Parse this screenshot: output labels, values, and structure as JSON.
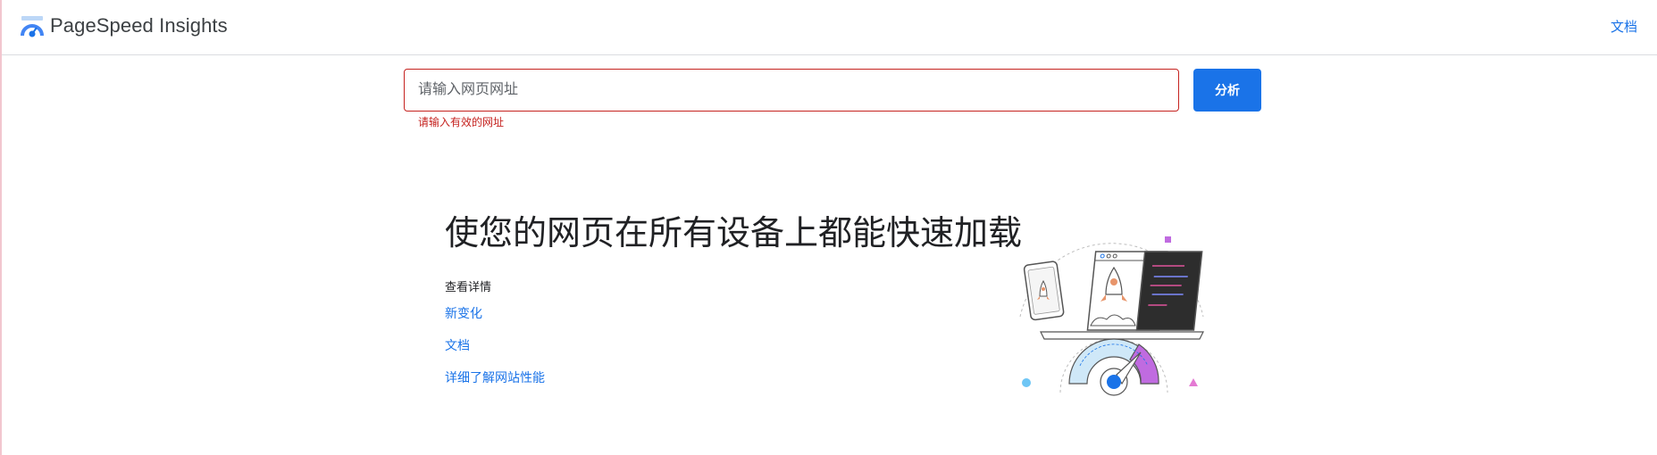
{
  "header": {
    "brand": "PageSpeed Insights",
    "docs_link": "文档"
  },
  "search": {
    "placeholder": "请输入网页网址",
    "value": "",
    "button_label": "分析",
    "error": "请输入有效的网址"
  },
  "hero": {
    "title": "使您的网页在所有设备上都能快速加载",
    "learn_more_heading": "查看详情",
    "links": [
      "新变化",
      "文档",
      "详细了解网站性能"
    ]
  },
  "colors": {
    "accent": "#1a73e8",
    "error": "#c5221f",
    "gauge_purple": "#c06be0",
    "gauge_light": "#cfe8f8",
    "code_panel": "#2d2d2d"
  },
  "icons": [
    "pagespeed-logo-icon",
    "hero-illustration"
  ]
}
